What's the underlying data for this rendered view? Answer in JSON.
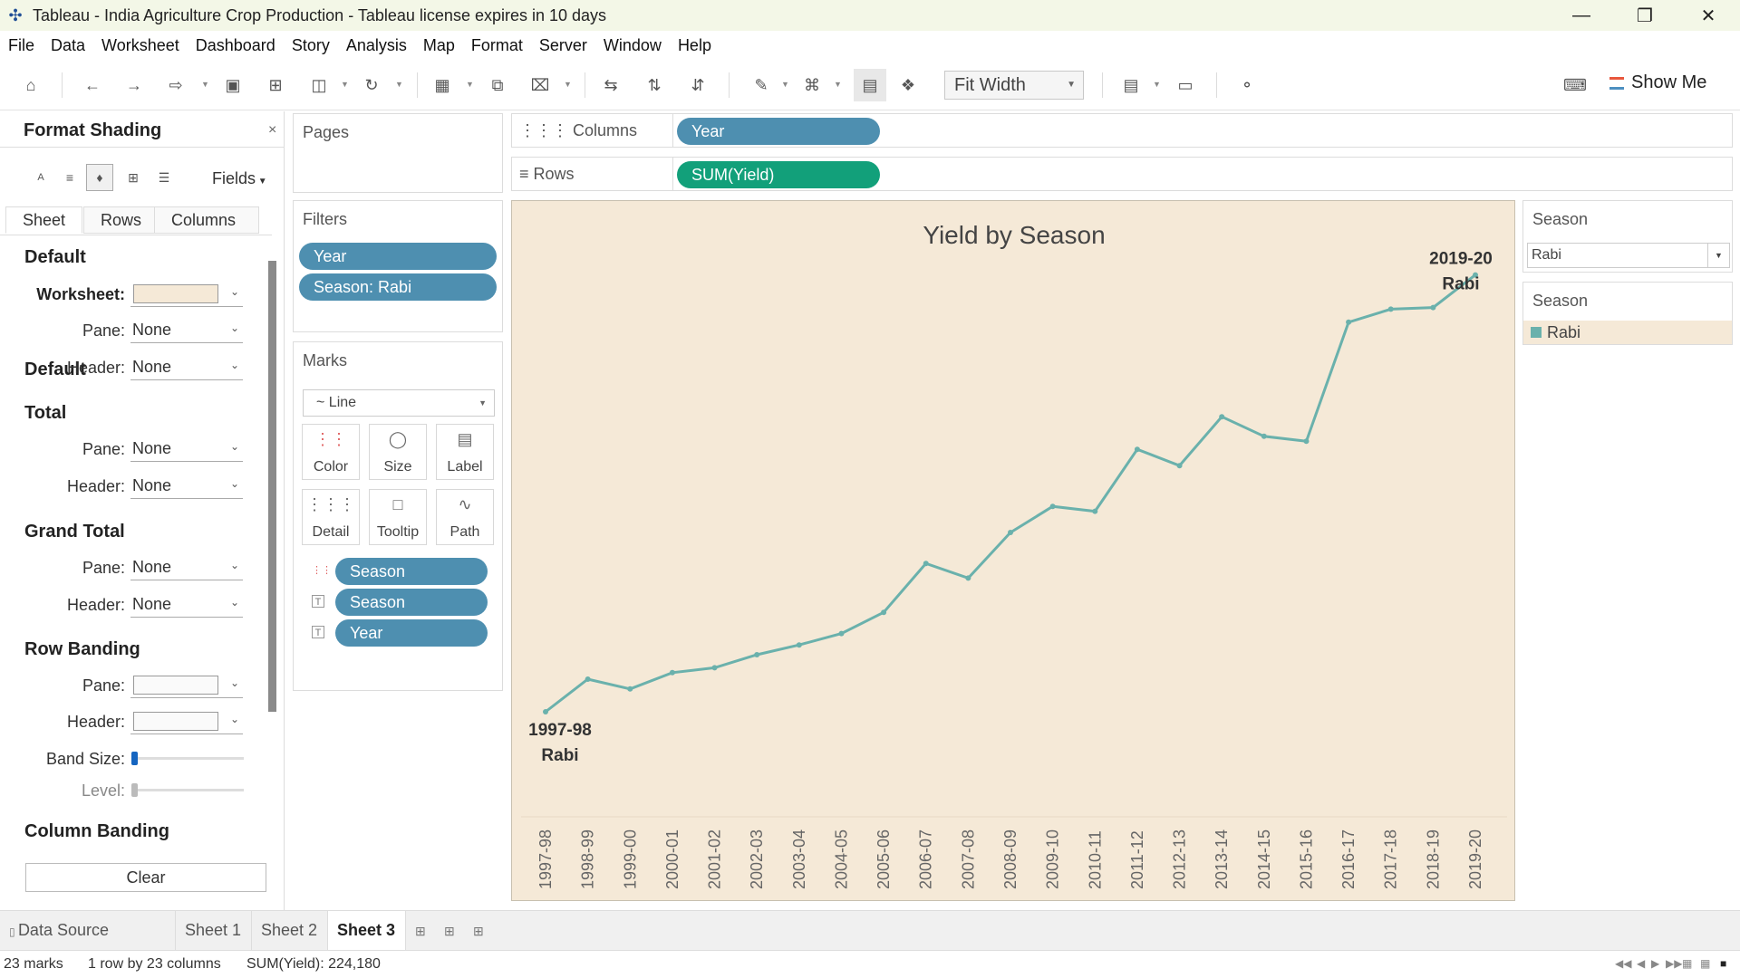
{
  "window": {
    "title": "Tableau - India Agriculture Crop Production - Tableau license expires in 10 days",
    "icons": [
      "tableau-logo-icon",
      "minimize-icon",
      "restore-icon",
      "close-icon"
    ]
  },
  "menu": [
    "File",
    "Data",
    "Worksheet",
    "Dashboard",
    "Story",
    "Analysis",
    "Map",
    "Format",
    "Server",
    "Window",
    "Help"
  ],
  "toolbar": {
    "fit": "Fit Width",
    "show_me": "Show Me"
  },
  "format_panel": {
    "title": "Format Shading",
    "fields": "Fields",
    "tabs": [
      "Sheet",
      "Rows",
      "Columns"
    ],
    "active_tab": "Sheet",
    "sections": {
      "default": "Default",
      "total": "Total",
      "grand_total": "Grand Total",
      "row_banding": "Row Banding",
      "column_banding": "Column Banding"
    },
    "labels": {
      "worksheet": "Worksheet:",
      "pane": "Pane:",
      "header": "Header:",
      "band_size": "Band Size:",
      "level": "Level:"
    },
    "none": "None",
    "worksheet_color": "#f5e9d7",
    "clear": "Clear"
  },
  "pages": {
    "title": "Pages"
  },
  "filters": {
    "title": "Filters",
    "pills": [
      "Year",
      "Season: Rabi"
    ]
  },
  "marks": {
    "title": "Marks",
    "type": "Line",
    "buttons": [
      "Color",
      "Size",
      "Label",
      "Detail",
      "Tooltip",
      "Path"
    ],
    "pills": [
      {
        "icon": "color-dots-icon",
        "label": "Season"
      },
      {
        "icon": "label-text-icon",
        "label": "Season"
      },
      {
        "icon": "label-text-icon",
        "label": "Year"
      }
    ]
  },
  "shelves": {
    "columns_label": "Columns",
    "columns_pill": "Year",
    "rows_label": "Rows",
    "rows_pill": "SUM(Yield)"
  },
  "chart_data": {
    "type": "line",
    "title": "Yield by Season",
    "x": [
      "1997-98",
      "1998-99",
      "1999-00",
      "2000-01",
      "2001-02",
      "2002-03",
      "2003-04",
      "2004-05",
      "2005-06",
      "2006-07",
      "2007-08",
      "2008-09",
      "2009-10",
      "2010-11",
      "2011-12",
      "2012-13",
      "2013-14",
      "2014-15",
      "2015-16",
      "2016-17",
      "2017-18",
      "2018-19",
      "2019-20"
    ],
    "series": [
      {
        "name": "Rabi",
        "values": [
          3500,
          4500,
          4200,
          4700,
          4850,
          5250,
          5550,
          5900,
          6550,
          8050,
          7600,
          9000,
          9800,
          9650,
          11550,
          11050,
          12550,
          11950,
          11800,
          15450,
          15850,
          15900,
          16900
        ]
      }
    ],
    "color": "#6ab1ac",
    "start_label": [
      "1997-98",
      "Rabi"
    ],
    "end_label": [
      "2019-20",
      "Rabi"
    ],
    "background": "#f5e9d7"
  },
  "season_filter": {
    "title": "Season",
    "value": "Rabi"
  },
  "season_legend": {
    "title": "Season",
    "items": [
      "Rabi"
    ]
  },
  "sheet_tabs": {
    "data_source": "Data Source",
    "sheets": [
      "Sheet 1",
      "Sheet 2",
      "Sheet 3"
    ],
    "active": "Sheet 3"
  },
  "status": {
    "marks": "23 marks",
    "dims": "1 row by 23 columns",
    "sum": "SUM(Yield): 224,180"
  }
}
